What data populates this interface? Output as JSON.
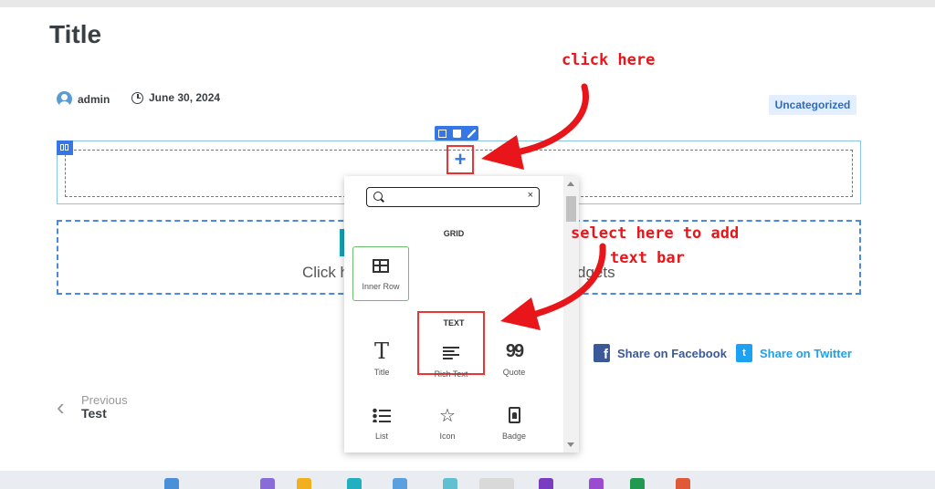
{
  "post": {
    "title": "Title",
    "author": "admin",
    "date": "June 30, 2024",
    "category": "Uncategorized"
  },
  "editor": {
    "add_button_symbol": "+",
    "drop_text_left": "Click h",
    "drop_text_right": "dgets"
  },
  "picker": {
    "search_placeholder": "",
    "clear_symbol": "×",
    "sections": [
      {
        "heading": "GRID",
        "items": [
          {
            "label": "Inner Row",
            "icon": "table-icon"
          }
        ]
      },
      {
        "heading": "TEXT",
        "items": [
          {
            "label": "Title",
            "icon": "title-icon",
            "glyph": "T"
          },
          {
            "label": "Rich Text",
            "icon": "rich-text-icon"
          },
          {
            "label": "Quote",
            "icon": "quote-icon",
            "glyph": "99"
          },
          {
            "label": "List",
            "icon": "list-icon"
          },
          {
            "label": "Icon",
            "icon": "star-icon",
            "glyph": "☆"
          },
          {
            "label": "Badge",
            "icon": "badge-icon"
          }
        ]
      }
    ]
  },
  "share": {
    "facebook": "Share on Facebook",
    "twitter": "Share on Twitter",
    "facebook_glyph": "f",
    "twitter_glyph": "t"
  },
  "nav": {
    "previous_label": "Previous",
    "previous_title": "Test",
    "chevron": "‹"
  },
  "annotations": {
    "click_here": "click here",
    "select_line1": "select here to add",
    "select_line2": "text bar",
    "color": "#e8161b"
  },
  "colors": {
    "accent": "#3578e5",
    "badge_bg": "#e3efff",
    "facebook": "#3b5998",
    "twitter": "#1da1f2",
    "highlight": "#e33333",
    "inner_row_border": "#6cbf6c"
  }
}
